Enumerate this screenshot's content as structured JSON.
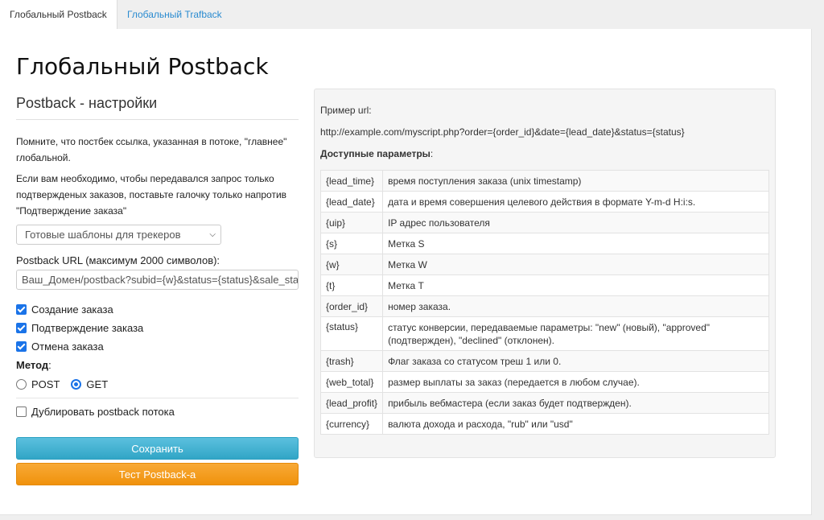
{
  "tabs": [
    {
      "label": "Глобальный Postback"
    },
    {
      "label": "Глобальный Trafback"
    }
  ],
  "page_title": "Глобальный Postback",
  "subtitle": "Postback - настройки",
  "info1": "Помните, что постбек ссылка, указанная в потоке, \"главнее\" глобальной.",
  "info2": "Если вам необходимо, чтобы передавался запрос только подтвержденых заказов, поставьте галочку только напротив \"Подтверждение заказа\"",
  "template_select": {
    "value": "Готовые шаблоны для трекеров"
  },
  "postback_url": {
    "label": "Postback URL (максимум 2000 символов):",
    "value": "Ваш_Домен/postback?subid={w}&status={status}&sale_status"
  },
  "checkboxes": [
    {
      "label": "Создание заказа",
      "checked": true
    },
    {
      "label": "Подтверждение заказа",
      "checked": true
    },
    {
      "label": "Отмена заказа",
      "checked": true
    }
  ],
  "method": {
    "label": "Метод",
    "suffix": ":",
    "options": [
      {
        "label": "POST",
        "selected": false
      },
      {
        "label": "GET",
        "selected": true
      }
    ]
  },
  "duplicate_checkbox": {
    "label": "Дублировать postback потока",
    "checked": false
  },
  "buttons": {
    "save": "Сохранить",
    "test": "Тест Postback-а"
  },
  "example": {
    "label": "Пример url:",
    "url": "http://example.com/myscript.php?order={order_id}&date={lead_date}&status={status}",
    "params_title": "Доступные параметры",
    "params_title_suffix": ":",
    "params": [
      {
        "key": "{lead_time}",
        "desc": "время поступления заказа (unix timestamp)"
      },
      {
        "key": "{lead_date}",
        "desc": "дата и время совершения целевого действия в формате Y-m-d H:i:s."
      },
      {
        "key": "{uip}",
        "desc": "IP адрес пользователя"
      },
      {
        "key": "{s}",
        "desc": "Метка S"
      },
      {
        "key": "{w}",
        "desc": "Метка W"
      },
      {
        "key": "{t}",
        "desc": "Метка T"
      },
      {
        "key": "{order_id}",
        "desc": "номер заказа."
      },
      {
        "key": "{status}",
        "desc": "статус конверсии, передаваемые параметры: \"new\" (новый), \"approved\" (подтвержден), \"declined\" (отклонен)."
      },
      {
        "key": "{trash}",
        "desc": "Флаг заказа со статусом треш 1 или 0."
      },
      {
        "key": "{web_total}",
        "desc": "размер выплаты за заказ (передается в любом случае)."
      },
      {
        "key": "{lead_profit}",
        "desc": "прибыль вебмастера (если заказ будет подтвержден)."
      },
      {
        "key": "{currency}",
        "desc": "валюта дохода и расхода, \"rub\" или \"usd\""
      }
    ]
  },
  "colors": {
    "link": "#2a8bd0",
    "save_button": "#5bc0de",
    "test_button": "#f0920c",
    "checkbox_accent": "#1a73e8"
  }
}
